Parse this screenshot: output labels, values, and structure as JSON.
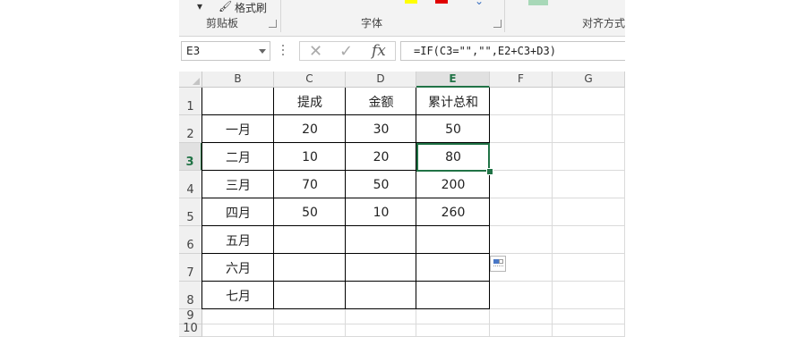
{
  "ribbon": {
    "format_painter": "格式刷",
    "groups": {
      "clipboard": "剪贴板",
      "font": "字体",
      "alignment": "对齐方式"
    },
    "colors": {
      "highlight": "#ffff00",
      "font_color": "#e00000",
      "align_swatch": "#a8d8b8"
    }
  },
  "formula_bar": {
    "name_box": "E3",
    "formula": "=IF(C3=\"\",\"\",E2+C3+D3)",
    "cancel_glyph": "✕",
    "enter_glyph": "✓",
    "fx_label": "fx"
  },
  "sheet": {
    "columns": [
      "B",
      "C",
      "D",
      "E",
      "F",
      "G"
    ],
    "selected_column": "E",
    "rows": [
      "1",
      "2",
      "3",
      "4",
      "5",
      "6",
      "7",
      "8",
      "9",
      "10"
    ],
    "selected_row": "3",
    "headers": [
      "",
      "提成",
      "金额",
      "累计总和"
    ],
    "data": [
      [
        "一月",
        "20",
        "30",
        "50"
      ],
      [
        "二月",
        "10",
        "20",
        "80"
      ],
      [
        "三月",
        "70",
        "50",
        "200"
      ],
      [
        "四月",
        "50",
        "10",
        "260"
      ],
      [
        "五月",
        "",
        "",
        ""
      ],
      [
        "六月",
        "",
        "",
        ""
      ],
      [
        "七月",
        "",
        "",
        ""
      ]
    ],
    "accent": "#217346"
  }
}
